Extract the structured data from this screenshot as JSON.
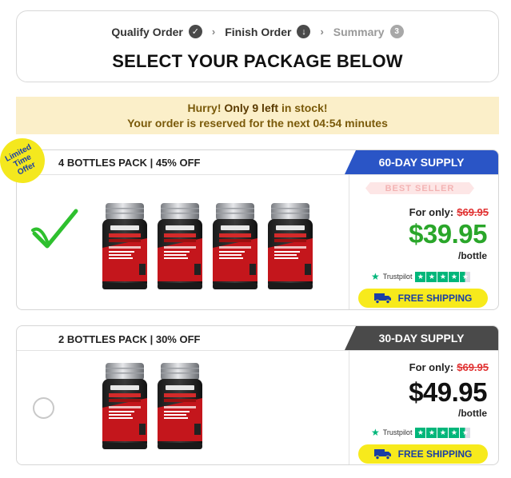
{
  "steps": [
    {
      "label": "Qualify Order",
      "icon": "check-circle-icon",
      "glyph": "✓",
      "state": "done"
    },
    {
      "label": "Finish Order",
      "icon": "download-circle-icon",
      "glyph": "↓",
      "state": "current"
    },
    {
      "label": "Summary",
      "icon": "number-circle-icon",
      "glyph": "3",
      "state": "upcoming"
    }
  ],
  "step_separator": "›",
  "headline": "SELECT YOUR PACKAGE BELOW",
  "stock": {
    "line1_pre": "Hurry! ",
    "line1_strong": "Only 9 left",
    "line1_post": " in stock!",
    "line2_pre": "Your order is reserved for the next ",
    "line2_timer": "04:54",
    "line2_post": " minutes"
  },
  "badge": {
    "line1": "Limited",
    "line2": "Time",
    "line3": "Offer"
  },
  "packages": [
    {
      "title": "4 BOTTLES PACK | 45% OFF",
      "supply": "60-DAY SUPPLY",
      "tab_color": "#2a55c6",
      "ribbon": "BEST SELLER",
      "for_only": "For only:",
      "old_price": "$69.95",
      "price": "$39.95",
      "per": "/bottle",
      "trust_label": "Trustpilot",
      "shipping": "FREE SHIPPING",
      "selected": true,
      "bottle_count": 4
    },
    {
      "title": "2 BOTTLES PACK | 30% OFF",
      "supply": "30-DAY SUPPLY",
      "tab_color": "#4a4a4a",
      "for_only": "For only:",
      "old_price": "$69.95",
      "price": "$49.95",
      "per": "/bottle",
      "trust_label": "Trustpilot",
      "shipping": "FREE SHIPPING",
      "selected": false,
      "bottle_count": 2
    }
  ],
  "colors": {
    "accent_blue": "#2a55c6",
    "price_green": "#2aa62a",
    "old_price_red": "#e03030",
    "shipping_yellow": "#f7ea1c",
    "stock_bg": "#fbefc9",
    "trustpilot_green": "#00b67a"
  }
}
